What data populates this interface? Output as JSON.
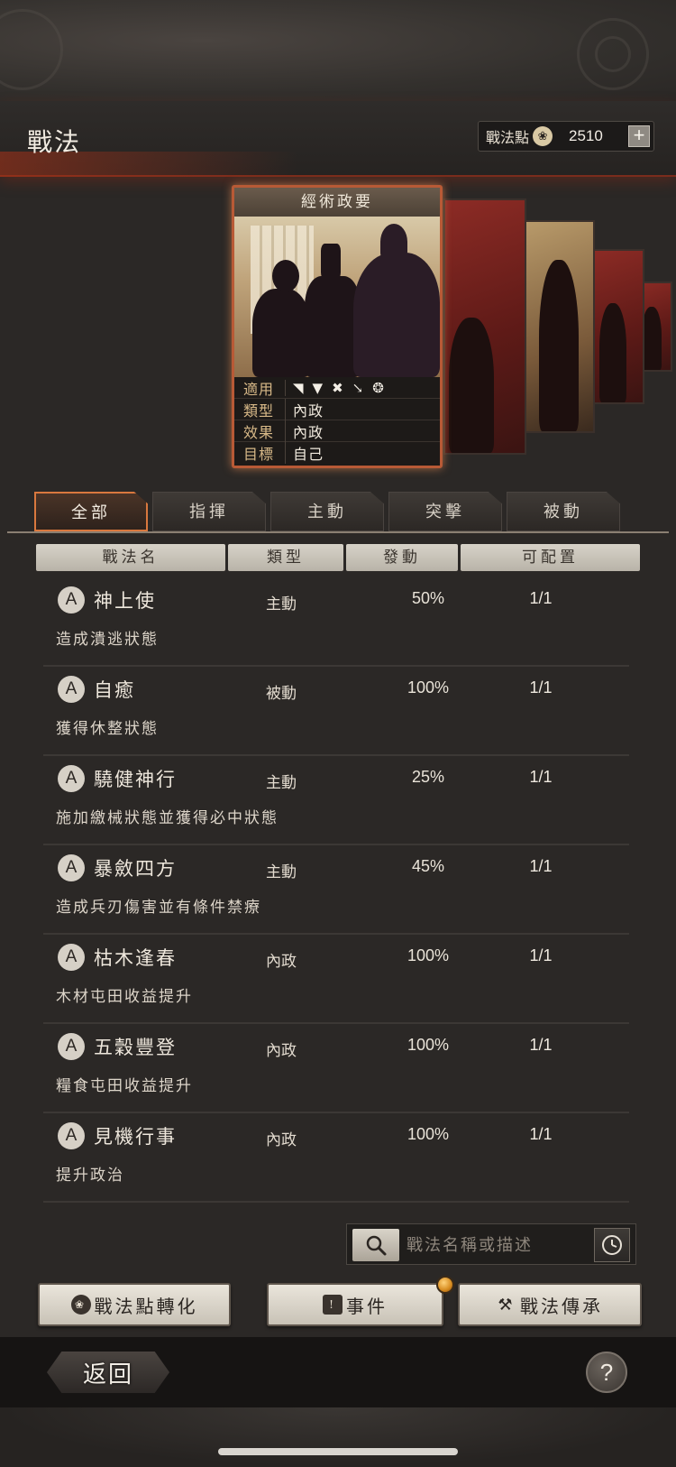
{
  "header": {
    "title": "戰法",
    "points_label": "戰法點",
    "points_icon": "flame-icon",
    "points_value": "2510",
    "add_label": "+"
  },
  "featured_card": {
    "title": "經術政要",
    "rows": [
      {
        "key": "適用",
        "value": ""
      },
      {
        "key": "類型",
        "value": "內政"
      },
      {
        "key": "效果",
        "value": "內政"
      },
      {
        "key": "目標",
        "value": "自己"
      }
    ],
    "unit_icons": [
      "axe-icon",
      "shield-icon",
      "crossed-bows-icon",
      "spear-icon",
      "wheel-icon"
    ]
  },
  "tabs": [
    {
      "label": "全部",
      "active": true
    },
    {
      "label": "指揮",
      "active": false
    },
    {
      "label": "主動",
      "active": false
    },
    {
      "label": "突擊",
      "active": false
    },
    {
      "label": "被動",
      "active": false
    }
  ],
  "columns": [
    "戰法名",
    "類型",
    "發動",
    "可配置"
  ],
  "tactics": [
    {
      "grade": "A",
      "name": "神上使",
      "type": "主動",
      "rate": "50%",
      "slots": "1/1",
      "desc": "造成潰逃狀態"
    },
    {
      "grade": "A",
      "name": "自癒",
      "type": "被動",
      "rate": "100%",
      "slots": "1/1",
      "desc": "獲得休整狀態"
    },
    {
      "grade": "A",
      "name": "驍健神行",
      "type": "主動",
      "rate": "25%",
      "slots": "1/1",
      "desc": "施加繳械狀態並獲得必中狀態"
    },
    {
      "grade": "A",
      "name": "暴斂四方",
      "type": "主動",
      "rate": "45%",
      "slots": "1/1",
      "desc": "造成兵刃傷害並有條件禁療"
    },
    {
      "grade": "A",
      "name": "枯木逢春",
      "type": "內政",
      "rate": "100%",
      "slots": "1/1",
      "desc": "木材屯田收益提升"
    },
    {
      "grade": "A",
      "name": "五穀豐登",
      "type": "內政",
      "rate": "100%",
      "slots": "1/1",
      "desc": "糧食屯田收益提升"
    },
    {
      "grade": "A",
      "name": "見機行事",
      "type": "內政",
      "rate": "100%",
      "slots": "1/1",
      "desc": "提升政治"
    }
  ],
  "search": {
    "placeholder": "戰法名稱或描述",
    "icon": "magnifier-icon",
    "history_icon": "clock-icon"
  },
  "actions": [
    {
      "label": "戰法點轉化",
      "icon": "flame-icon"
    },
    {
      "label": "事件",
      "icon": "alert-icon"
    },
    {
      "label": "戰法傳承",
      "icon": "hammer-icon"
    }
  ],
  "footer": {
    "back_label": "返回",
    "help_label": "?"
  },
  "colors": {
    "accent": "#d9783e",
    "background": "#2b2826",
    "header_glow": "#7a2c1c"
  }
}
